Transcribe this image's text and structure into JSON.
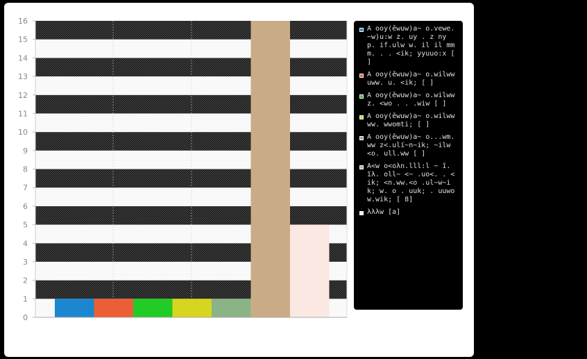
{
  "chart_data": {
    "type": "bar",
    "title": "",
    "xlabel": "",
    "ylabel": "",
    "ylim": [
      0,
      16
    ],
    "yticks": [
      "0",
      "1",
      "2",
      "3",
      "4",
      "5",
      "6",
      "7",
      "8",
      "9",
      "10",
      "11",
      "12",
      "13",
      "14",
      "15",
      "16"
    ],
    "grid": true,
    "legend_position": "right",
    "series": [
      {
        "name": "A ooy(ěwuw)a~ o.vewe. ~w)u:w z. uy . z ny p. if.ulw w. il il mmm. . . <ik; yyuuo:x [ ]",
        "value": 1,
        "color": "#1a87d0"
      },
      {
        "name": "A ooy(ěwuw)a~ o.wilww uww. u. <ik; [ ]",
        "value": 1,
        "color": "#ec5f36"
      },
      {
        "name": "A ooy(ěwuw)a~ o.wilww z. <wo . . .wiw [ ]",
        "value": 1,
        "color": "#22cc27"
      },
      {
        "name": "A ooy(ěwuw)a~ o.wilww ww. wwomti; [ ]",
        "value": 1,
        "color": "#d6d620"
      },
      {
        "name": "A ooy(ěwuw)a~ o...wm.ww z<.ulí~n~ik; ~ilw <o. ull.ww [ ]",
        "value": 1,
        "color": "#8ab386"
      },
      {
        "name": "A<w o<oλn.lll:l ~ ĩ. ĩλ. oll~ <~ .uo<. . <ik; <n.ww.<o .ul~w~ik; w. o . uuk; . uuwow.wik; [ 8]",
        "value": 16,
        "color": "#c9ac87"
      },
      {
        "name": "λλλw [a]",
        "value": 5,
        "color": "#fbe8e2"
      }
    ]
  }
}
